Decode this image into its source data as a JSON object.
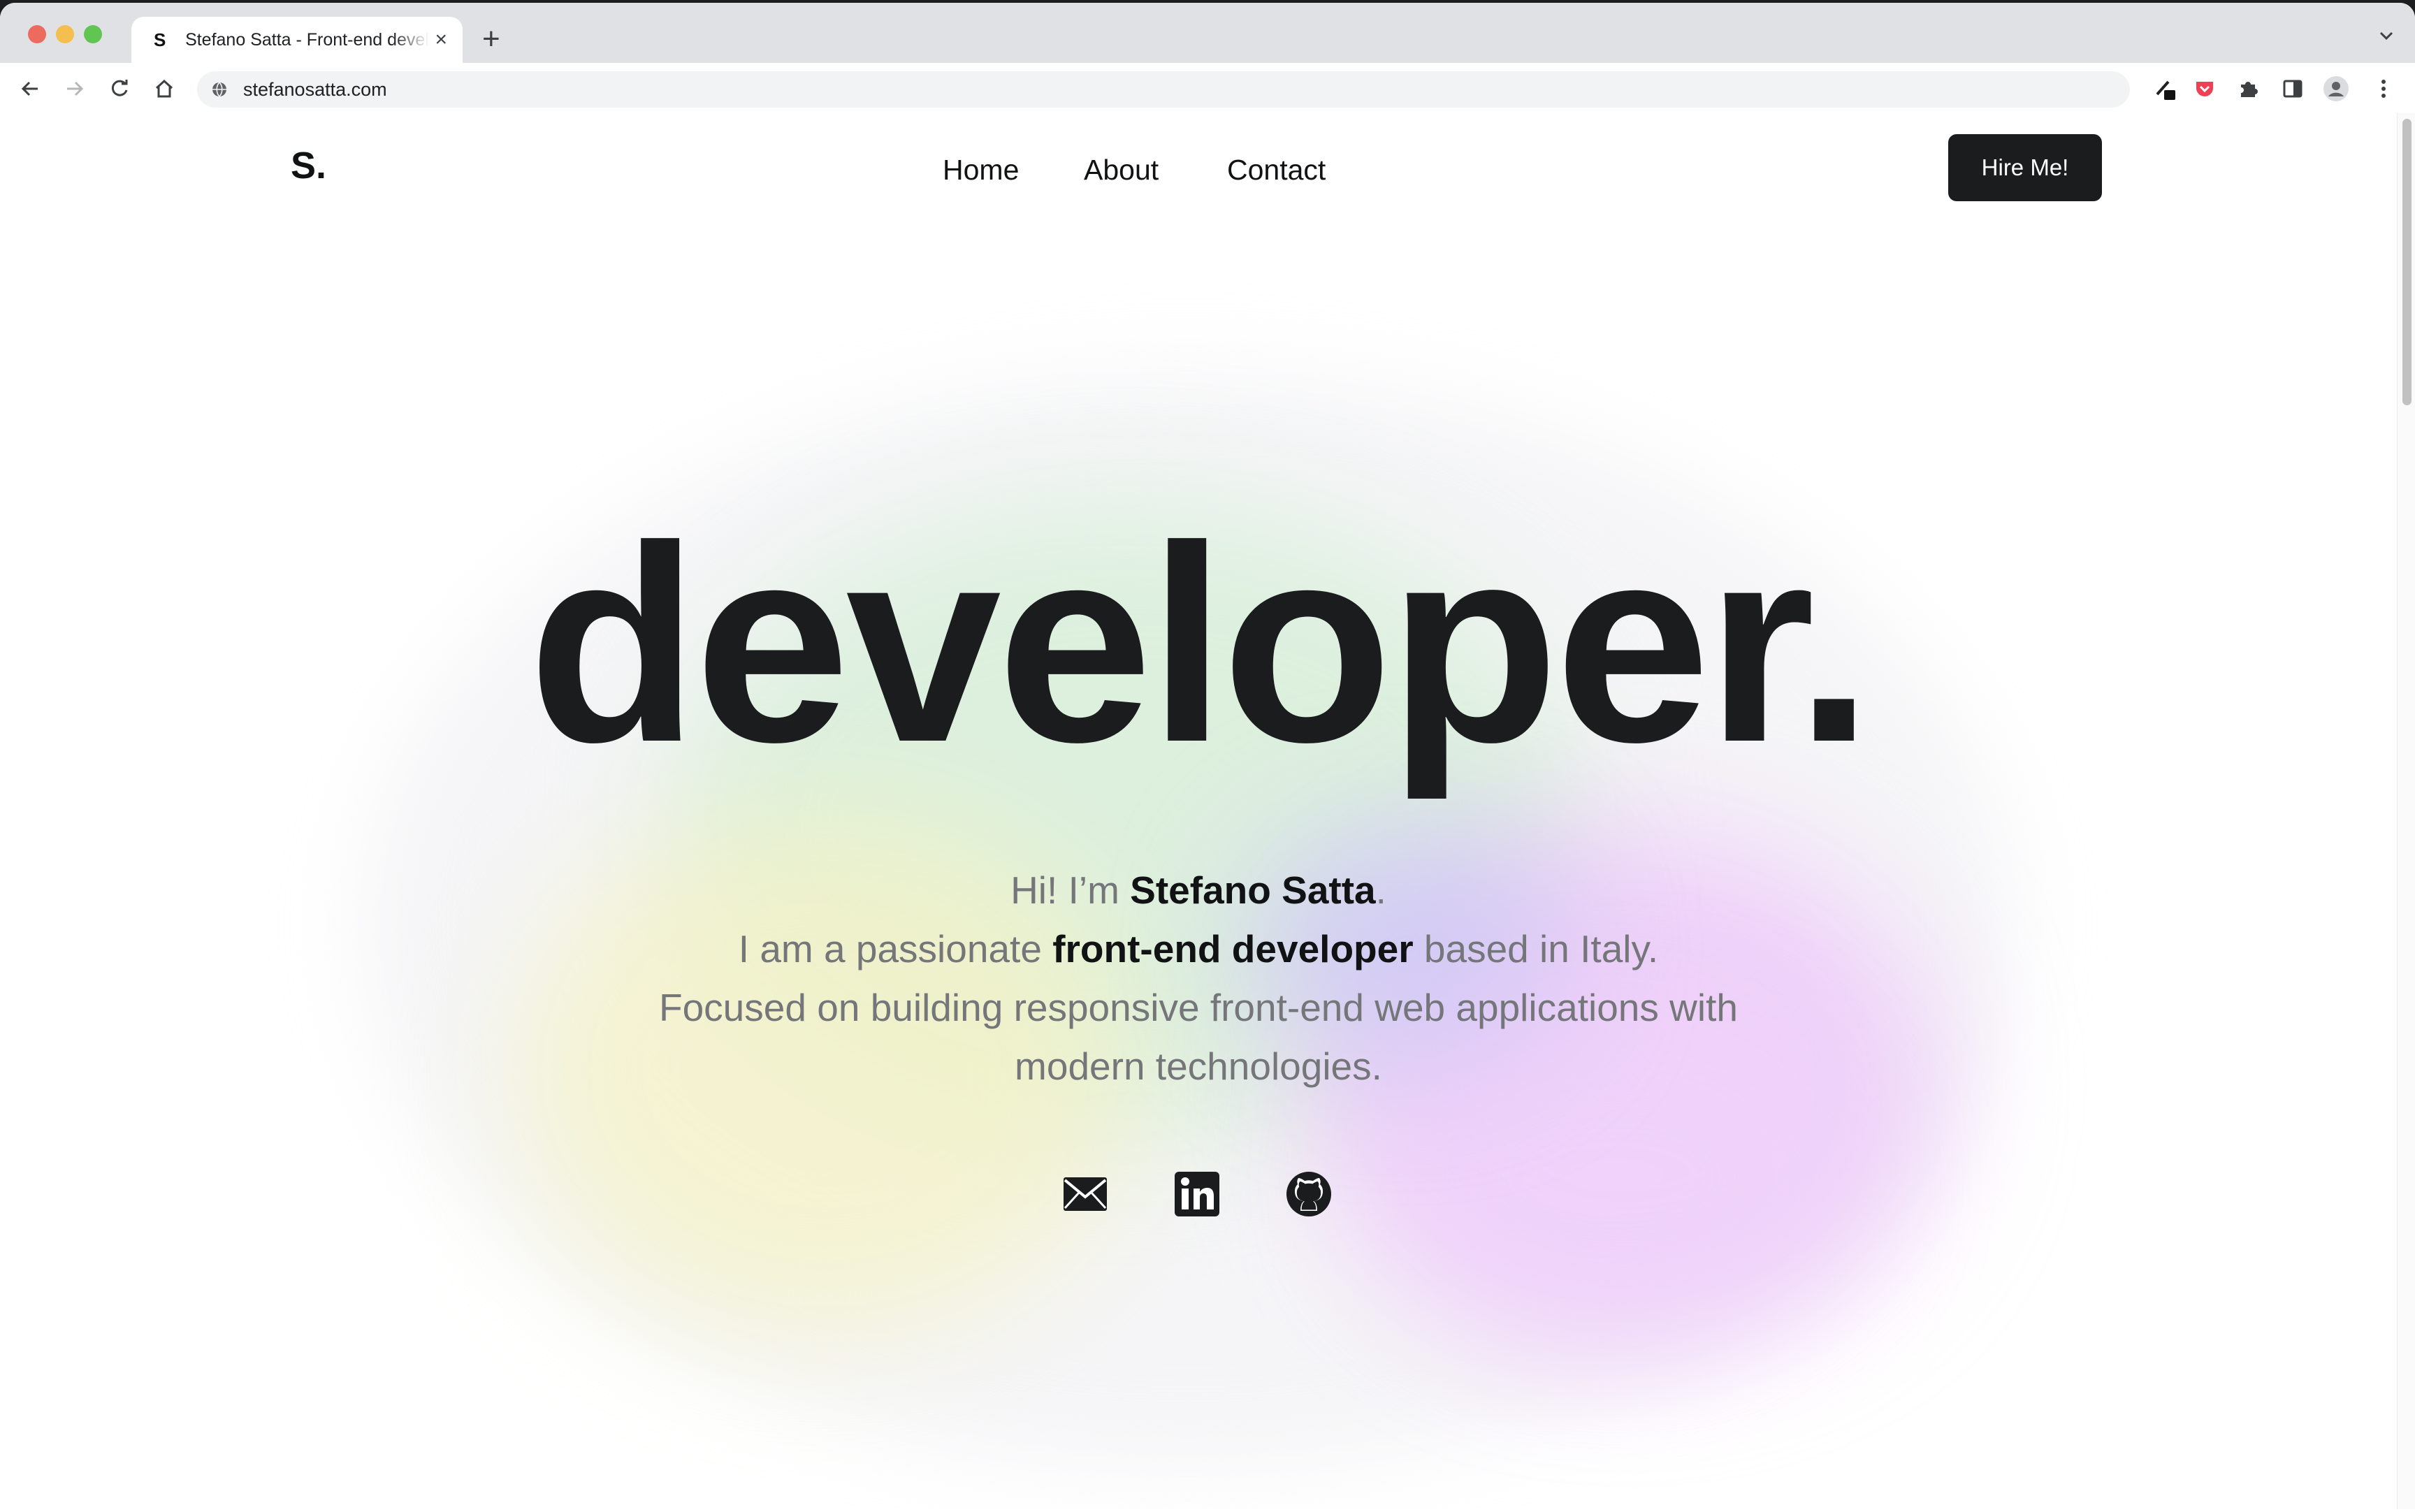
{
  "browser": {
    "tab_favicon": "S",
    "tab_title": "Stefano Satta - Front-end developer",
    "tab_close": "×",
    "new_tab": "+",
    "url": "stefanosatta.com"
  },
  "site": {
    "logo": "S.",
    "nav": [
      "Home",
      "About",
      "Contact"
    ],
    "cta": "Hire Me!",
    "headline": "developer."
  },
  "intro": {
    "line1_prefix": "Hi! I’m ",
    "name": "Stefano Satta",
    "line1_suffix": ".",
    "line2_prefix": "I am a passionate ",
    "role": "front-end developer",
    "line2_suffix": " based in Italy.",
    "line3": "Focused on building responsive front-end web applications with",
    "line4": "modern technologies."
  },
  "socials": [
    "mail-icon",
    "linkedin-icon",
    "github-icon"
  ],
  "colors": {
    "text_dark": "#1b1c1e",
    "text_muted": "#75767a",
    "button_bg": "#1b1c1e"
  }
}
